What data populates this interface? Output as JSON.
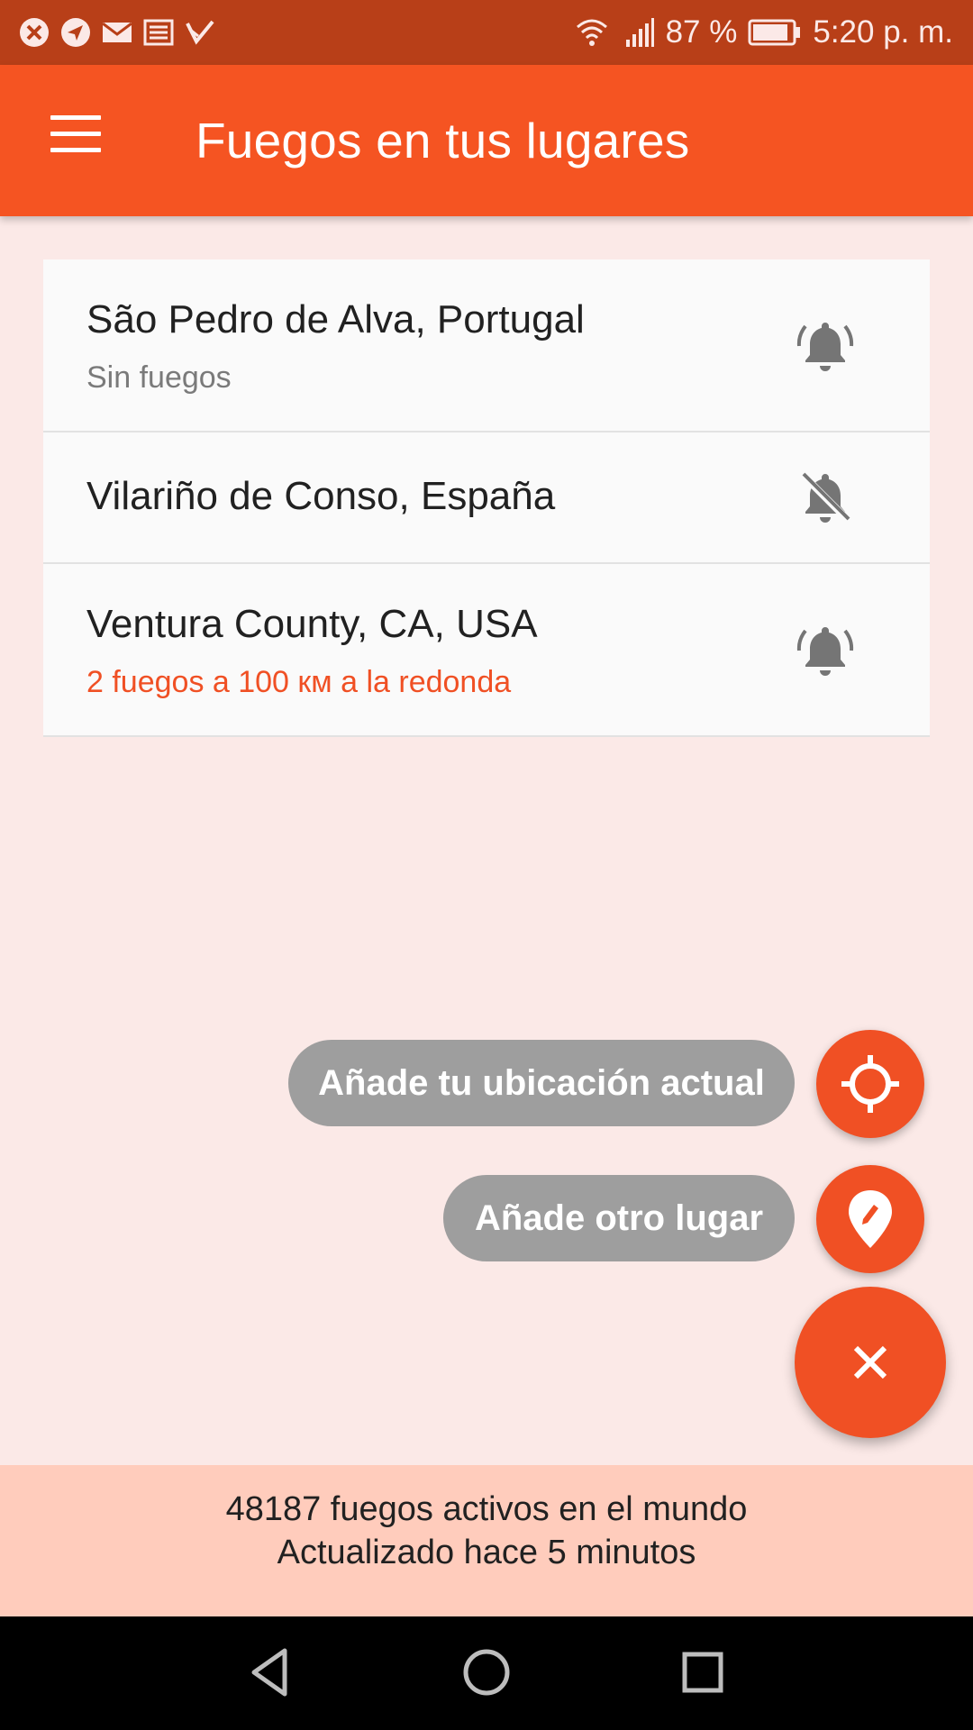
{
  "status_bar": {
    "battery_text": "87 %",
    "time": "5:20 p. m.",
    "left_icons": [
      "close-circle-icon",
      "navigation-icon",
      "mail-icon",
      "news-icon",
      "check-icon"
    ],
    "right_icons": [
      "wifi-icon",
      "signal-icon",
      "battery-icon"
    ]
  },
  "app_bar": {
    "title": "Fuegos en tus lugares",
    "menu_icon": "hamburger-menu-icon"
  },
  "places": [
    {
      "name": "São Pedro de Alva, Portugal",
      "status": "Sin fuegos",
      "status_color": "#7a7a7a",
      "notifications": "on"
    },
    {
      "name": "Vilariño de Conso, España",
      "status": "",
      "notifications": "off"
    },
    {
      "name": "Ventura County, CA, USA",
      "status": "2 fuegos a 100 км a la redonda",
      "status_color": "#f05024",
      "notifications": "on"
    }
  ],
  "actions": {
    "current_location_label": "Añade tu ubicación actual",
    "current_location_icon": "crosshair-icon",
    "other_place_label": "Añade otro lugar",
    "other_place_icon": "map-pin-edit-icon",
    "close_icon": "close-icon"
  },
  "footer": {
    "line1": "48187 fuegos activos en el mundo",
    "line2": "Actualizado hace 5 minutos"
  },
  "colors": {
    "status_bar": "#b83f18",
    "app_bar": "#f55422",
    "accent": "#f05024",
    "background": "#fbe9e7",
    "footer": "#ffccbc",
    "chip": "#9e9e9e"
  }
}
